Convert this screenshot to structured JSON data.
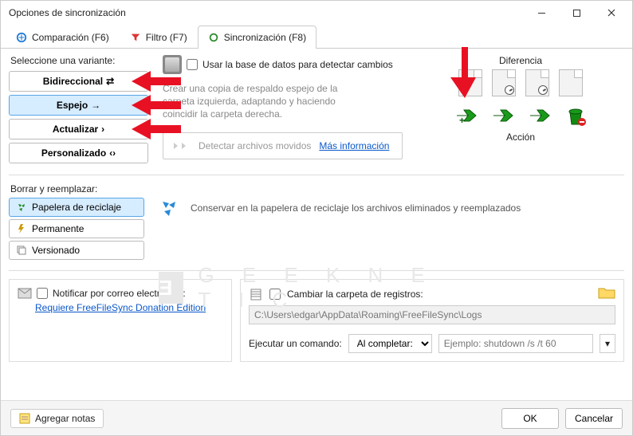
{
  "window": {
    "title": "Opciones de sincronización"
  },
  "tabs": {
    "compare": "Comparación (F6)",
    "filter": "Filtro (F7)",
    "sync": "Sincronización (F8)"
  },
  "variants": {
    "label": "Seleccione una variante:",
    "bidir": "Bidireccional",
    "mirror": "Espejo",
    "update": "Actualizar",
    "custom": "Personalizado"
  },
  "dbcheck_label": "Usar la base de datos para detectar cambios",
  "mirror_desc": "Crear una copia de respaldo espejo de la carpeta izquierda, adaptando y haciendo coincidir la carpeta derecha.",
  "detect": {
    "label": "Detectar archivos movidos",
    "link": "Más información"
  },
  "diff": {
    "title": "Diferencia",
    "action": "Acción"
  },
  "delete": {
    "label": "Borrar y reemplazar:",
    "recycle": "Papelera de reciclaje",
    "perm": "Permanente",
    "vers": "Versionado",
    "desc": "Conservar en la papelera de reciclaje los archivos eliminados y reemplazados"
  },
  "email": {
    "label": "Notificar por correo electrónico:",
    "link": "Requiere FreeFileSync Donation Edition"
  },
  "logs": {
    "label": "Cambiar la carpeta de registros:",
    "path": "C:\\Users\\edgar\\AppData\\Roaming\\FreeFileSync\\Logs"
  },
  "exec": {
    "label": "Ejecutar un comando:",
    "when": "Al completar:",
    "placeholder": "Ejemplo: shutdown /s /t 60"
  },
  "footer": {
    "notes": "Agregar notas",
    "ok": "OK",
    "cancel": "Cancelar"
  },
  "watermark": "G E E K N E T I C"
}
